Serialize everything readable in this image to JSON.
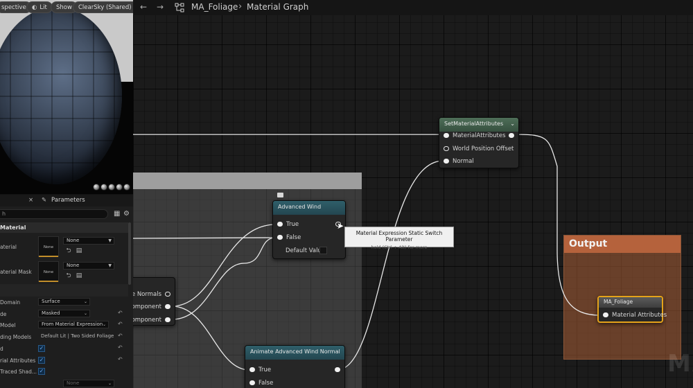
{
  "viewport": {
    "perspective_label": "spective",
    "lit_label": "Lit",
    "show_label": "Show",
    "skylight_label": "ClearSky (Shared)"
  },
  "details": {
    "tab_close": "×",
    "tab_parameters": "Parameters",
    "search_placeholder": "h",
    "section_title": "Material",
    "rows": {
      "material": "aterial",
      "material_mask": "aterial Mask",
      "domain": "Domain",
      "blend_mode": "de",
      "shading_model": "Model",
      "shading_models": "ding Models",
      "two_sided": "d",
      "material_attributes": "rial Attributes",
      "ray_traced": "Traced Shad..."
    },
    "thumb_none": "None",
    "combo_none": "None",
    "values": {
      "domain": "Surface",
      "blend_mode": "Masked",
      "shading_model": "From Material Expression",
      "shading_models": "Default Lit | Two Sided Foliage",
      "bottom_none": "None"
    }
  },
  "graph": {
    "asset_name": "MA_Foliage",
    "graph_name": "Material Graph",
    "set_attrs": {
      "title": "SetMaterialAttributes",
      "pins": [
        "MaterialAttributes",
        "World Position Offset",
        "Normal"
      ]
    },
    "advanced_wind": {
      "title": "Advanced Wind",
      "pin_true": "True",
      "pin_false": "False",
      "default_value": "Default Value"
    },
    "left_node": {
      "pins": [
        "ace Normals",
        "Component",
        "Component"
      ]
    },
    "animate_node": {
      "title": "Animate Advanced Wind Normal",
      "pin_true": "True",
      "pin_false": "False"
    },
    "output": {
      "title": "Output",
      "node_title": "MA_Foliage",
      "pin": "Material Attributes"
    },
    "tooltip": {
      "title": "Material Expression Static Switch Parameter",
      "hint": "hold (Ctrl + Alt) for more"
    },
    "watermark": "MA"
  }
}
